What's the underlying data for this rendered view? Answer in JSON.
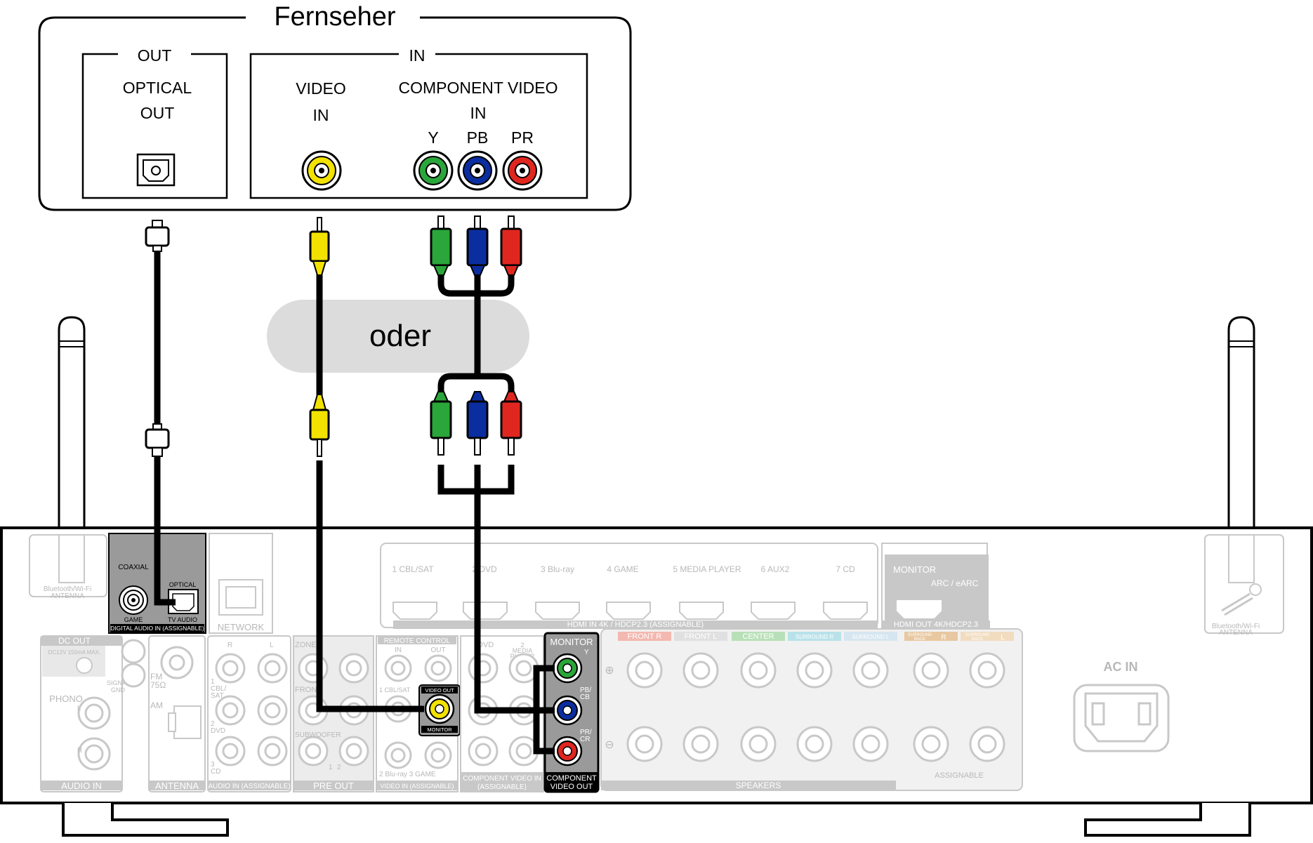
{
  "tv": {
    "title": "Fernseher",
    "out_label": "OUT",
    "in_label": "IN",
    "optical_out": [
      "OPTICAL",
      "OUT"
    ],
    "video_in": [
      "VIDEO",
      "IN"
    ],
    "component_in": [
      "COMPONENT VIDEO",
      "IN"
    ],
    "y": "Y",
    "pb": "PB",
    "pr": "PR"
  },
  "oder": "oder",
  "receiver": {
    "bt_antenna": [
      "Bluetooth/Wi-Fi",
      "ANTENNA"
    ],
    "coaxial": "COAXIAL",
    "optical": "OPTICAL",
    "game": "GAME",
    "tv_audio": "TV AUDIO",
    "digital_audio_in": "DIGITAL AUDIO IN (ASSIGNABLE)",
    "network": "NETWORK",
    "hdmi_inputs": [
      "1 CBL/SAT",
      "2 DVD",
      "3 Blu-ray",
      "4 GAME",
      "5 MEDIA PLAYER",
      "6 AUX2",
      "7 CD"
    ],
    "hdmi_in": "HDMI IN  4K / HDCP2.3 (ASSIGNABLE)",
    "monitor": "MONITOR",
    "arc": "ARC / eARC",
    "hdmi_out": "HDMI OUT 4K/HDCP2.3",
    "dc_out": "DC OUT",
    "dc_spec": "DC12V 150mA MAX.",
    "signal_gnd": [
      "SIGNAL",
      "GND"
    ],
    "fm": [
      "FM",
      "75Ω"
    ],
    "am": "AM",
    "phono": "PHONO",
    "audio_in": "AUDIO IN",
    "antenna": "ANTENNA",
    "audio_in_assignable": "AUDIO IN (ASSIGNABLE)",
    "cbl_sat": [
      "1",
      "CBL/",
      "SAT"
    ],
    "dvd": [
      "2",
      "DVD"
    ],
    "cd": [
      "3",
      "CD"
    ],
    "zone2": "ZONE2",
    "front": "FRONT",
    "subwoofer": "SUBWOOFER",
    "pre_out": "PRE OUT",
    "remote_control": "REMOTE CONTROL",
    "rc_in": "IN",
    "rc_out": "OUT",
    "cbl_sat_small": "1 CBL/SAT",
    "video_out": "VIDEO OUT",
    "monitor_small": "MONITOR",
    "blu_ray_game": "2 Blu-ray  3 GAME",
    "video_in_assignable": "VIDEO IN (ASSIGNABLE)",
    "dvd_label": "DVD",
    "media_player": [
      "2",
      "MEDIA",
      "PLAYER"
    ],
    "component_video_in": [
      "COMPONENT VIDEO IN",
      "(ASSIGNABLE)"
    ],
    "monitor_comp": "MONITOR",
    "comp_y": "Y",
    "comp_pb": [
      "PB/",
      "CB"
    ],
    "comp_pr": [
      "PR/",
      "CR"
    ],
    "component_video_out": [
      "COMPONENT",
      "VIDEO OUT"
    ],
    "speakers_front_r": "FRONT R",
    "speakers_front_l": "FRONT L",
    "speakers_center": "CENTER",
    "speakers_surround_r": "SURROUND R",
    "speakers_surround_l": "SURROUND L",
    "speakers_sb_r": [
      "SURROUND",
      "BACK",
      "R"
    ],
    "speakers_sb_l": [
      "SURROUND",
      "BACK",
      "L"
    ],
    "speakers": "SPEAKERS",
    "assignable": "ASSIGNABLE",
    "ac_in": "AC IN",
    "plus": "⊕",
    "minus": "⊖",
    "l": "L",
    "r": "R",
    "sw_nums": [
      "1",
      "2"
    ]
  },
  "colors": {
    "y_green": "#2aa63a",
    "pb_blue": "#0a2ea0",
    "pr_red": "#e0271f",
    "video_yellow": "#f2e200",
    "faded_gray": "#c8c8c8",
    "panel_gray": "#9a9a9a",
    "oder_gray": "#dcdcdc"
  }
}
